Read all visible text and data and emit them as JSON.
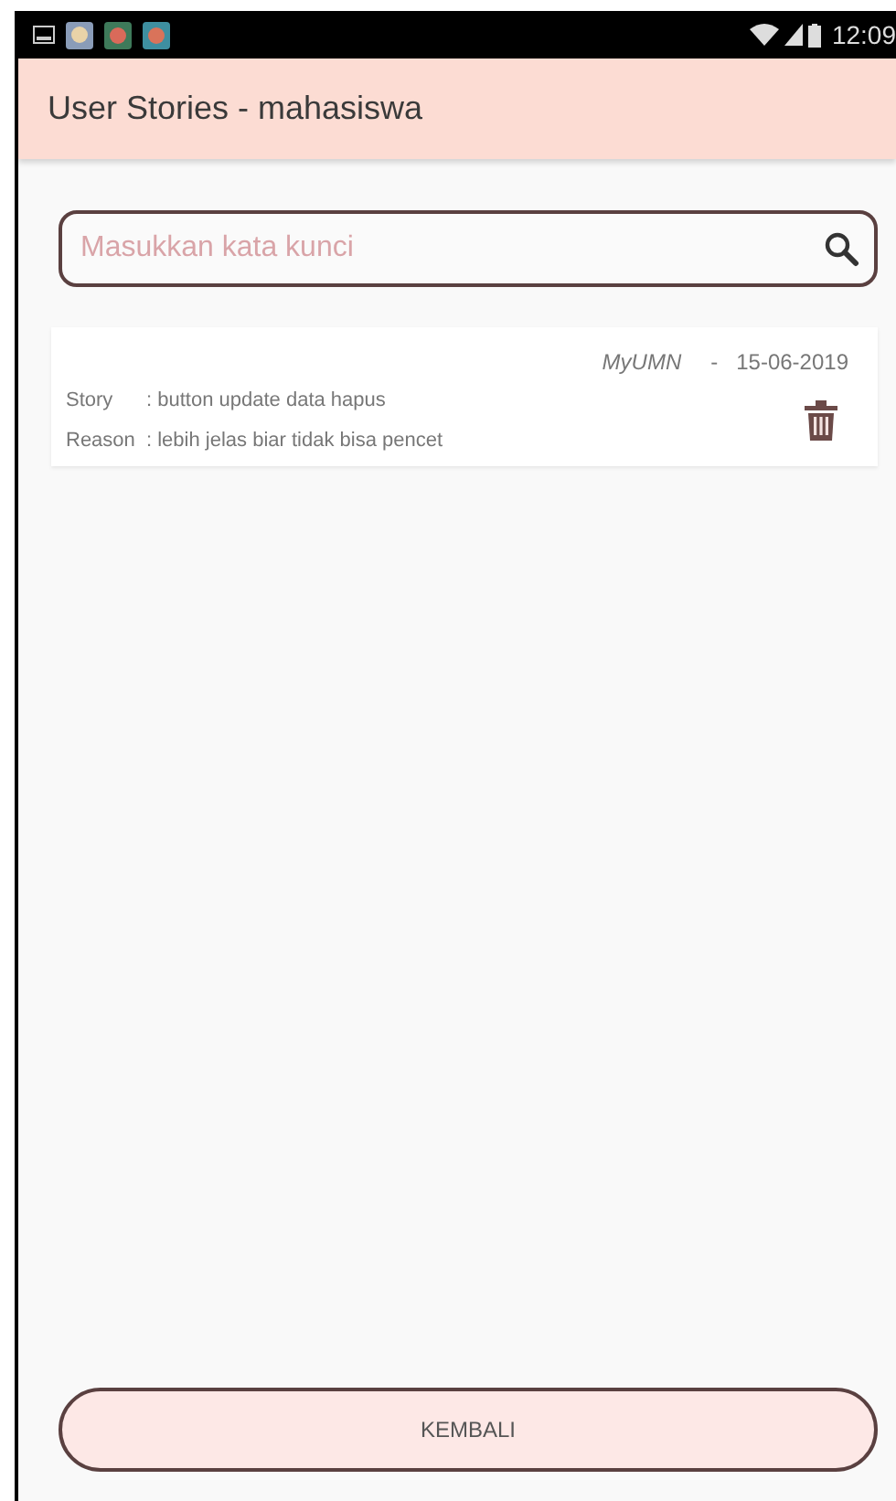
{
  "status_bar": {
    "time": "12:09"
  },
  "app_bar": {
    "title": "User Stories - mahasiswa"
  },
  "search": {
    "placeholder": "Masukkan kata kunci"
  },
  "stories": [
    {
      "app": "MyUMN",
      "separator": "-",
      "date": "15-06-2019",
      "story_label": "Story",
      "story": ": button update data hapus",
      "reason_label": "Reason",
      "reason": ": lebih jelas biar tidak bisa pencet"
    }
  ],
  "back_button": {
    "label": "KEMBALI"
  }
}
